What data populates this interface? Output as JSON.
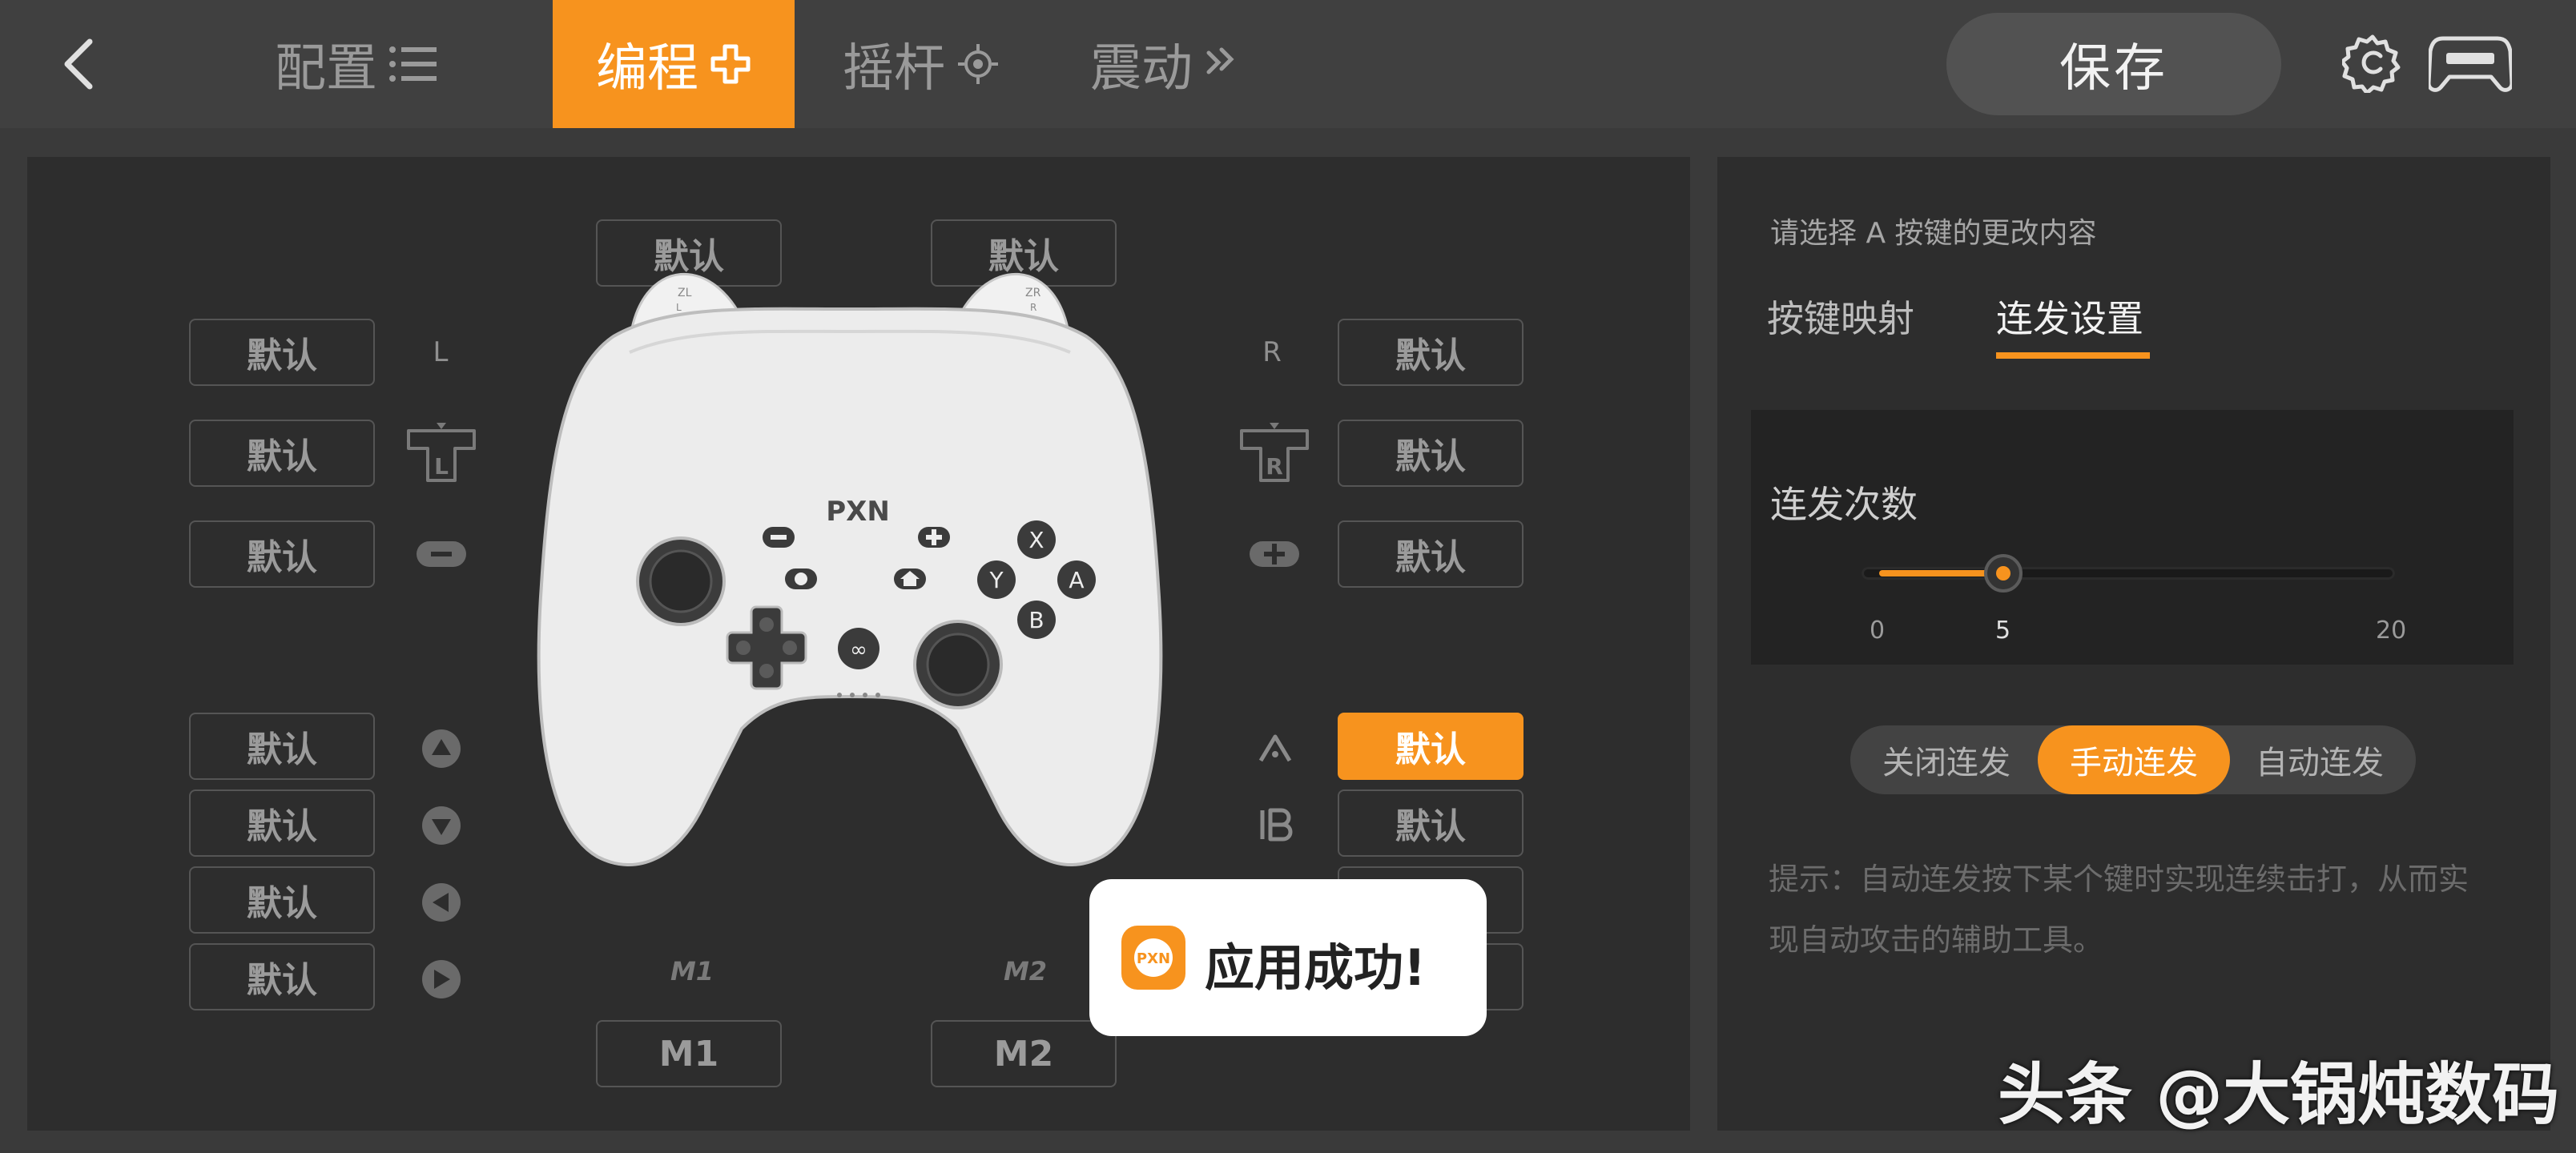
{
  "header": {
    "tabs": [
      {
        "label": "配置",
        "icon": "list-icon"
      },
      {
        "label": "编程",
        "icon": "plus-icon"
      },
      {
        "label": "摇杆",
        "icon": "crosshair-icon"
      },
      {
        "label": "震动",
        "icon": "vibration-icon"
      }
    ],
    "active_tab": "编程",
    "save_label": "保存",
    "icons": [
      "back-arrow-icon",
      "settings-gear-icon",
      "controller-icon"
    ]
  },
  "mapping": {
    "top_buttons": [
      {
        "label": "默认",
        "key": "ZL"
      },
      {
        "label": "默认",
        "key": "ZR"
      }
    ],
    "top_labels": {
      "zl": "ZL",
      "zr": "ZR",
      "l": "L",
      "r": "R"
    },
    "left_buttons": [
      {
        "label": "默认",
        "key": "L"
      },
      {
        "label": "默认",
        "key": "L3"
      },
      {
        "label": "默认",
        "key": "Minus"
      },
      {
        "label": "默认",
        "key": "Up"
      },
      {
        "label": "默认",
        "key": "Down"
      },
      {
        "label": "默认",
        "key": "Left"
      },
      {
        "label": "默认",
        "key": "Right"
      }
    ],
    "right_buttons": [
      {
        "label": "默认",
        "key": "R"
      },
      {
        "label": "默认",
        "key": "R3"
      },
      {
        "label": "默认",
        "key": "Plus"
      },
      {
        "label": "默认",
        "key": "A",
        "active": true
      },
      {
        "label": "默认",
        "key": "B"
      },
      {
        "label": "默认",
        "key": "X"
      },
      {
        "label": "默认",
        "key": "Y"
      }
    ],
    "bottom_buttons": [
      {
        "label": "M1",
        "glyph": "M1"
      },
      {
        "label": "M2",
        "glyph": "M2"
      }
    ],
    "gamepad": {
      "brand": "PXN",
      "shoulder_left": "ZL",
      "shoulder_left_sub": "L",
      "shoulder_right": "ZR",
      "shoulder_right_sub": "R"
    }
  },
  "settings": {
    "prompt": "请选择 A 按键的更改内容",
    "tabs": [
      "按键映射",
      "连发设置"
    ],
    "active_tab": "连发设置",
    "slider": {
      "title": "连发次数",
      "min": 0,
      "max": 20,
      "value": 5,
      "min_label": "0",
      "max_label": "20",
      "value_label": "5"
    },
    "modes": [
      "关闭连发",
      "手动连发",
      "自动连发"
    ],
    "active_mode": "手动连发",
    "hint": "提示：自动连发按下某个键时实现连续击打，从而实现自动攻击的辅助工具。"
  },
  "toast": {
    "text": "应用成功!"
  },
  "watermark": "头条 @大锅炖数码",
  "colors": {
    "accent": "#f7931e",
    "panel": "#2d2d2d",
    "topbar": "#404040"
  }
}
